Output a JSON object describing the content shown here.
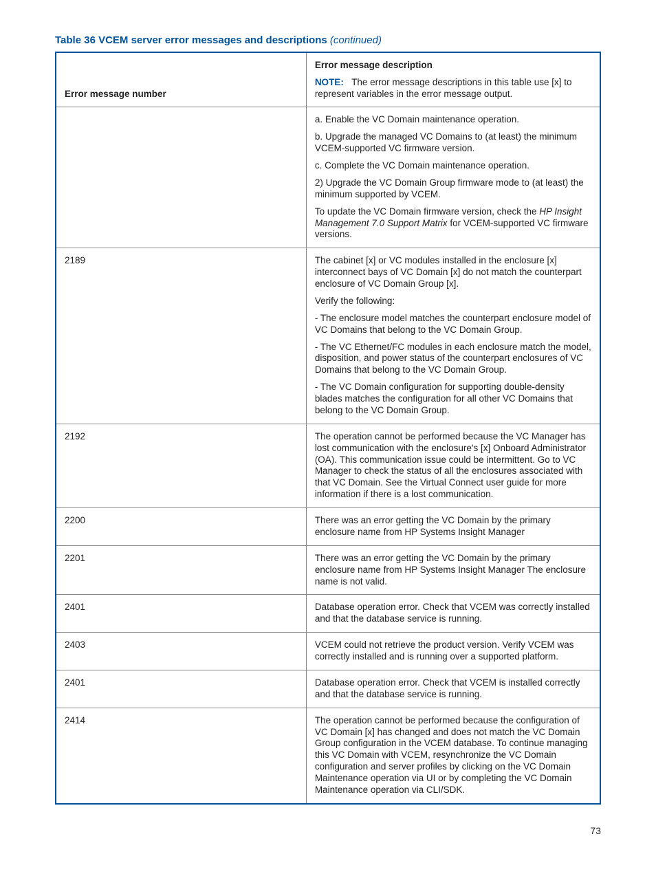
{
  "title": {
    "label": "Table 36 VCEM server error messages and descriptions",
    "continued": "(continued)"
  },
  "headers": {
    "col1": "Error message number",
    "col2_main": "Error message description",
    "col2_note_label": "NOTE:",
    "col2_note_text": "The error message descriptions in this table use [x] to represent variables in the error message output."
  },
  "rows": [
    {
      "num": "",
      "desc": [
        "a. Enable the VC Domain maintenance operation.",
        "b. Upgrade the managed VC Domains to (at least) the minimum VCEM-supported VC firmware version.",
        "c. Complete the VC Domain maintenance operation.",
        "2) Upgrade the VC Domain Group firmware mode to (at least) the minimum supported by VCEM.",
        "To update the VC Domain firmware version, check the <span class=\"italic\">HP Insight Management 7.0 Support Matrix</span> for VCEM-supported VC firmware versions."
      ]
    },
    {
      "num": "2189",
      "desc": [
        "The cabinet [x] or VC modules installed in the enclosure [x] interconnect bays of VC Domain [x] do not match the counterpart enclosure of VC Domain Group [x].",
        "Verify the following:",
        "- The enclosure model matches the counterpart enclosure model of VC Domains that belong to the VC Domain Group.",
        "- The VC Ethernet/FC modules in each enclosure match the model, disposition, and power status of the counterpart enclosures of VC Domains that belong to the VC Domain Group.",
        "- The VC Domain configuration for supporting double-density blades matches the configuration for all other VC Domains that belong to the VC Domain Group."
      ]
    },
    {
      "num": "2192",
      "desc": [
        "The operation cannot be performed because the VC Manager has lost communication with the enclosure's [x] Onboard Administrator (OA). This communication issue could be intermittent. Go to VC Manager to check the status of all the enclosures associated with that VC Domain. See the Virtual Connect user guide for more information if there is a lost communication."
      ]
    },
    {
      "num": "2200",
      "desc": [
        "There was an error getting the VC Domain by the primary enclosure name from HP Systems Insight Manager"
      ]
    },
    {
      "num": "2201",
      "desc": [
        "There was an error getting the VC Domain by the primary enclosure name from HP Systems Insight Manager The enclosure name is not valid."
      ]
    },
    {
      "num": "2401",
      "desc": [
        "Database operation error. Check that VCEM was correctly installed and that the database service is running."
      ]
    },
    {
      "num": "2403",
      "desc": [
        "VCEM could not retrieve the product version. Verify VCEM was correctly installed and is running over a supported platform."
      ]
    },
    {
      "num": "2401",
      "desc": [
        "Database operation error. Check that VCEM is installed correctly and that the database service is running."
      ]
    },
    {
      "num": "2414",
      "desc": [
        "The operation cannot be performed because the configuration of VC Domain [x] has changed and does not match the VC Domain Group configuration in the VCEM database. To continue managing this VC Domain with VCEM, resynchronize the VC Domain configuration and server profiles by clicking on the VC Domain Maintenance operation via UI or by completing the VC Domain Maintenance operation via CLI/SDK."
      ]
    }
  ],
  "page_number": "73"
}
